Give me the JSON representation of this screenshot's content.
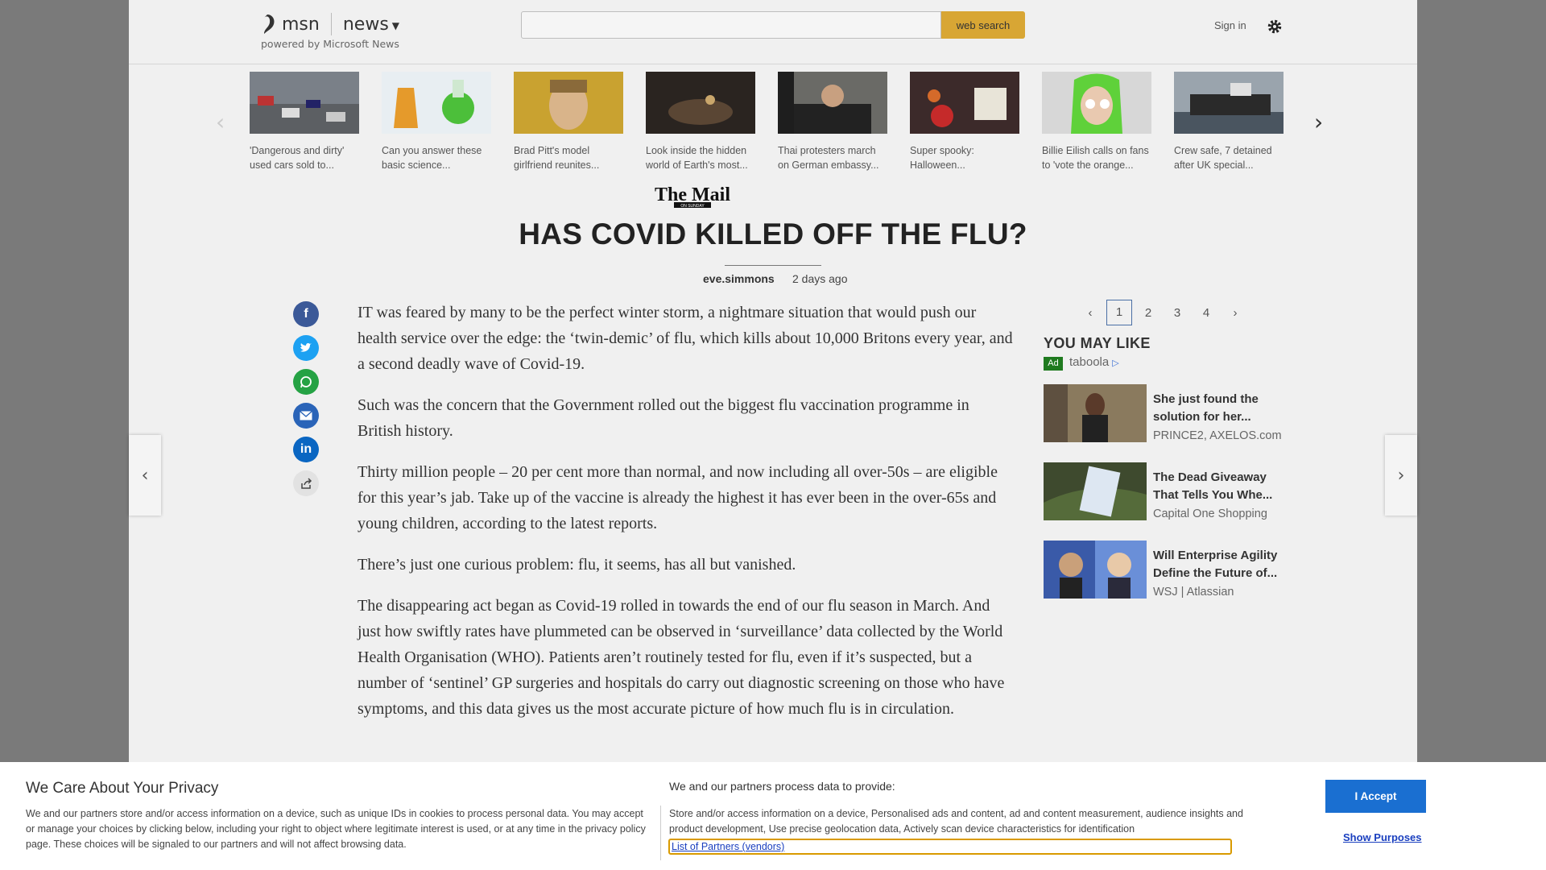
{
  "header": {
    "brand": "msn",
    "section": "news",
    "powered_by": "powered by Microsoft News",
    "search_placeholder": "",
    "search_button": "web search",
    "sign_in": "Sign in"
  },
  "carousel": {
    "items": [
      {
        "caption": "'Dangerous and dirty' used cars sold to..."
      },
      {
        "caption": "Can you answer these basic science..."
      },
      {
        "caption": "Brad Pitt's model girlfriend reunites..."
      },
      {
        "caption": "Look inside the hidden world of Earth's most..."
      },
      {
        "caption": "Thai protesters march on German embassy..."
      },
      {
        "caption": "Super spooky: Halloween..."
      },
      {
        "caption": "Billie Eilish calls on fans to 'vote the orange..."
      },
      {
        "caption": "Crew safe, 7 detained after UK special..."
      }
    ]
  },
  "article": {
    "source": "The Mail on Sunday",
    "headline": "HAS COVID KILLED OFF THE FLU?",
    "author": "eve.simmons",
    "time": "2 days ago",
    "paragraphs": [
      "IT was feared by many to be the perfect winter storm, a nightmare situation that would push our health service over the edge: the ‘twin-demic’ of flu, which kills about 10,000 Britons every year, and a second deadly wave of Covid-19.",
      "Such was the concern that the Government rolled out the biggest flu vaccination programme in British history.",
      "Thirty million people – 20 per cent more than normal, and now including all over-50s – are eligible for this year’s jab. Take up of the vaccine is already the highest it has ever been in the over-65s and young children, according to the latest reports.",
      "There’s just one curious problem: flu, it seems, has all but vanished.",
      "The disappearing act began as Covid-19 rolled in towards the end of our flu season in March. And just how swiftly rates have plummeted can be observed in ‘surveillance’ data collected by the World Health Organisation (WHO). Patients aren’t routinely tested for flu, even if it’s suspected, but a number of ‘sentinel’ GP surgeries and hospitals do carry out diagnostic screening on those who have symptoms, and this data gives us the most accurate picture of how much flu is in circulation."
    ]
  },
  "share": {
    "icons": [
      "facebook-icon",
      "twitter-icon",
      "whatsapp-icon",
      "email-icon",
      "linkedin-icon",
      "share-icon"
    ]
  },
  "rail": {
    "pages": [
      "1",
      "2",
      "3",
      "4"
    ],
    "you_may_like": "YOU MAY LIKE",
    "ad_label": "Ad",
    "sponsor": "taboola",
    "promos": [
      {
        "title": "She just found the solution for her...",
        "source": "PRINCE2, AXELOS.com"
      },
      {
        "title": "The Dead Giveaway That Tells You Whe...",
        "source": "Capital One Shopping"
      },
      {
        "title": "Will Enterprise Agility Define the Future of...",
        "source": "WSJ | Atlassian"
      }
    ]
  },
  "consent": {
    "title": "We Care About Your Privacy",
    "left_text": "We and our partners store and/or access information on a device, such as unique IDs in cookies to process personal data. You may accept or manage your choices by clicking below, including your right to object where legitimate interest is used, or at any time in the privacy policy page. These choices will be signaled to our partners and will not affect browsing data.",
    "right_heading": "We and our partners process data to provide:",
    "right_text": "Store and/or access information on a device, Personalised ads and content, ad and content measurement, audience insights and product development, Use precise geolocation data, Actively scan device characteristics for identification",
    "partners_link": "List of Partners (vendors)",
    "accept": "I Accept",
    "show_purposes": "Show Purposes"
  },
  "colors": {
    "accent_search": "#d8a634",
    "accept_button": "#1a6fd1",
    "facebook": "#3b5998",
    "twitter": "#1da1f2",
    "whatsapp": "#25a244",
    "email": "#2a64b8",
    "linkedin": "#0a66c2"
  }
}
